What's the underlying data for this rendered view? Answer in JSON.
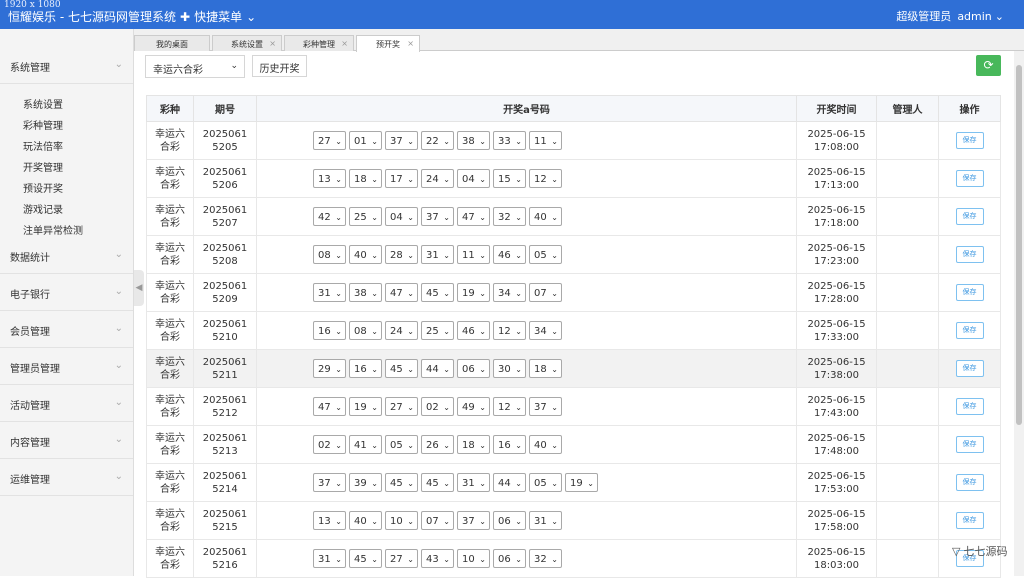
{
  "header": {
    "resolution": "1920 x 1080",
    "title": "恒耀娱乐 - 七七源码网管理系统",
    "quick_menu": "快捷菜单",
    "role": "超级管理员",
    "username": "admin"
  },
  "sidebar": {
    "groups": [
      "系统管理",
      "数据统计",
      "电子银行",
      "会员管理",
      "管理员管理",
      "活动管理",
      "内容管理",
      "运维管理"
    ],
    "subitems": [
      "系统设置",
      "彩种管理",
      "玩法倍率",
      "开奖管理",
      "预设开奖",
      "游戏记录",
      "注单异常检测"
    ]
  },
  "tabs": [
    {
      "label": "我的桌面"
    },
    {
      "label": "系统设置"
    },
    {
      "label": "彩种管理"
    },
    {
      "label": "预开奖"
    }
  ],
  "toolbar": {
    "lottery": "幸运六合彩",
    "history": "历史开奖"
  },
  "table": {
    "headers": [
      "彩种",
      "期号",
      "开奖a号码",
      "开奖时间",
      "管理人",
      "操作"
    ],
    "rows": [
      {
        "lottery": "幸运六合彩",
        "issue": "20250615205",
        "nums": [
          "27",
          "01",
          "37",
          "22",
          "38",
          "33",
          "11"
        ],
        "date": "2025-06-15",
        "time": "17:08:00",
        "admin": "",
        "action": "保存"
      },
      {
        "lottery": "幸运六合彩",
        "issue": "20250615206",
        "nums": [
          "13",
          "18",
          "17",
          "24",
          "04",
          "15",
          "12"
        ],
        "date": "2025-06-15",
        "time": "17:13:00",
        "admin": "",
        "action": "保存"
      },
      {
        "lottery": "幸运六合彩",
        "issue": "20250615207",
        "nums": [
          "42",
          "25",
          "04",
          "37",
          "47",
          "32",
          "40"
        ],
        "date": "2025-06-15",
        "time": "17:18:00",
        "admin": "",
        "action": "保存"
      },
      {
        "lottery": "幸运六合彩",
        "issue": "20250615208",
        "nums": [
          "08",
          "40",
          "28",
          "31",
          "11",
          "46",
          "05"
        ],
        "date": "2025-06-15",
        "time": "17:23:00",
        "admin": "",
        "action": "保存"
      },
      {
        "lottery": "幸运六合彩",
        "issue": "20250615209",
        "nums": [
          "31",
          "38",
          "47",
          "45",
          "19",
          "34",
          "07"
        ],
        "date": "2025-06-15",
        "time": "17:28:00",
        "admin": "",
        "action": "保存"
      },
      {
        "lottery": "幸运六合彩",
        "issue": "20250615210",
        "nums": [
          "16",
          "08",
          "24",
          "25",
          "46",
          "12",
          "34"
        ],
        "date": "2025-06-15",
        "time": "17:33:00",
        "admin": "",
        "action": "保存"
      },
      {
        "lottery": "幸运六合彩",
        "issue": "20250615211",
        "nums": [
          "29",
          "16",
          "45",
          "44",
          "06",
          "30",
          "18"
        ],
        "date": "2025-06-15",
        "time": "17:38:00",
        "admin": "",
        "action": "保存"
      },
      {
        "lottery": "幸运六合彩",
        "issue": "20250615212",
        "nums": [
          "47",
          "19",
          "27",
          "02",
          "49",
          "12",
          "37"
        ],
        "date": "2025-06-15",
        "time": "17:43:00",
        "admin": "",
        "action": "保存"
      },
      {
        "lottery": "幸运六合彩",
        "issue": "20250615213",
        "nums": [
          "02",
          "41",
          "05",
          "26",
          "18",
          "16",
          "40"
        ],
        "date": "2025-06-15",
        "time": "17:48:00",
        "admin": "",
        "action": "保存"
      },
      {
        "lottery": "幸运六合彩",
        "issue": "20250615214",
        "nums": [
          "37",
          "39",
          "45",
          "45",
          "31",
          "44",
          "05",
          "19"
        ],
        "date": "2025-06-15",
        "time": "17:53:00",
        "admin": "",
        "action": "保存"
      },
      {
        "lottery": "幸运六合彩",
        "issue": "20250615215",
        "nums": [
          "13",
          "40",
          "10",
          "07",
          "37",
          "06",
          "31"
        ],
        "date": "2025-06-15",
        "time": "17:58:00",
        "admin": "",
        "action": "保存"
      },
      {
        "lottery": "幸运六合彩",
        "issue": "20250615216",
        "nums": [
          "31",
          "45",
          "27",
          "43",
          "10",
          "06",
          "32"
        ],
        "date": "2025-06-15",
        "time": "18:03:00",
        "admin": "",
        "action": "保存"
      }
    ]
  },
  "watermark": "七七源码",
  "colors": {
    "header": "#2f6fd6",
    "refresh": "#48b85b",
    "save": "#3a96e0"
  }
}
